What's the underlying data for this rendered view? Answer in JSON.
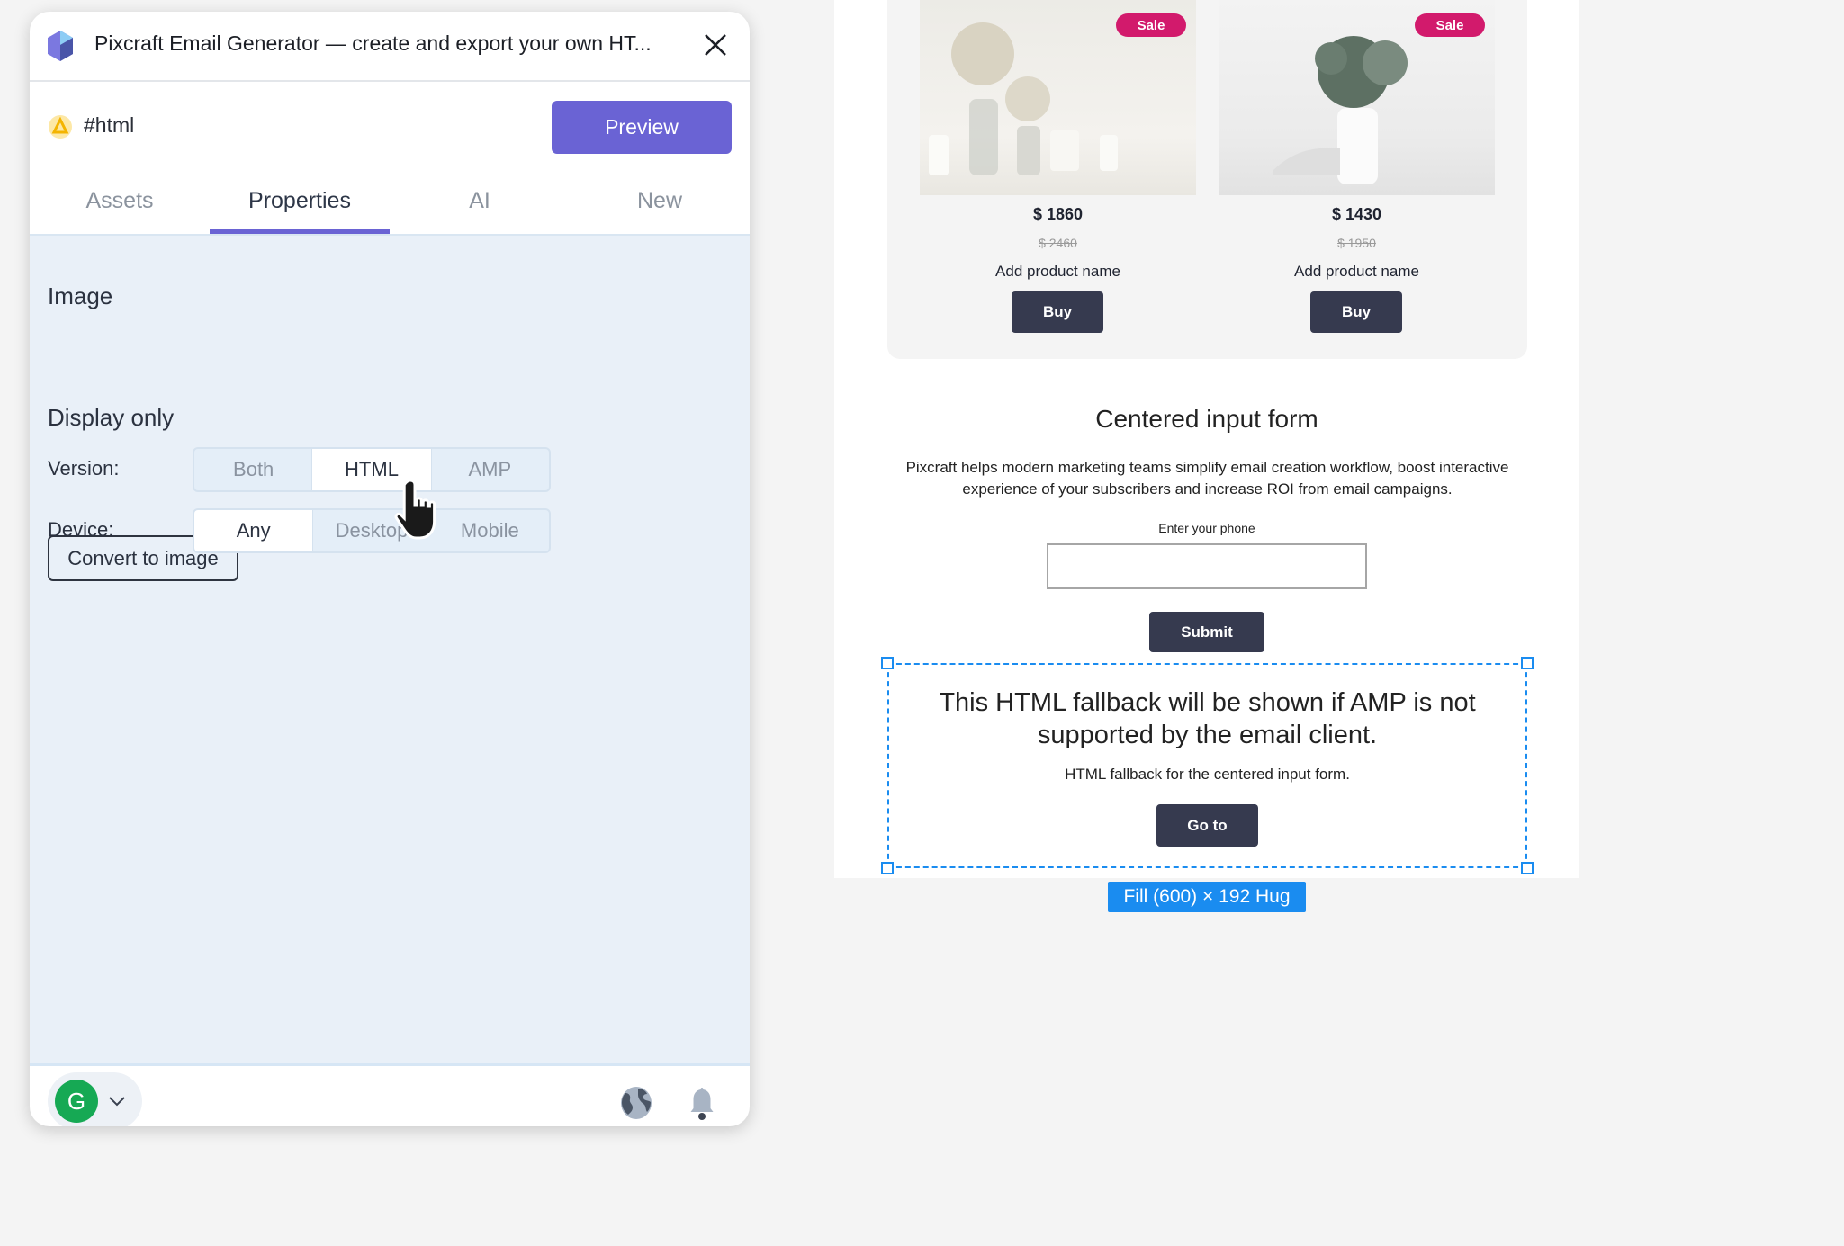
{
  "panel": {
    "title": "Pixcraft Email Generator — create and export your own HT...",
    "tag": "#html",
    "preview_label": "Preview",
    "tabs": [
      {
        "label": "Assets"
      },
      {
        "label": "Properties",
        "active": true
      },
      {
        "label": "AI"
      },
      {
        "label": "New"
      }
    ],
    "image_heading": "Image",
    "convert_label": "Convert to image",
    "display_heading": "Display only",
    "version": {
      "label": "Version:",
      "options": [
        "Both",
        "HTML",
        "AMP"
      ],
      "selected": "HTML"
    },
    "device": {
      "label": "Device:",
      "options": [
        "Any",
        "Desktop",
        "Mobile"
      ],
      "selected": "Any"
    },
    "user_initial": "G",
    "accent": "#6a63d4"
  },
  "email": {
    "products": [
      {
        "badge": "Sale",
        "price": "$ 1860",
        "old_price": "$ 2460",
        "name": "Add product name",
        "button": "Buy"
      },
      {
        "badge": "Sale",
        "price": "$ 1430",
        "old_price": "$ 1950",
        "name": "Add product name",
        "button": "Buy"
      }
    ],
    "form": {
      "title": "Centered input form",
      "description": "Pixcraft helps modern marketing teams simplify email creation workflow, boost interactive experience of your subscribers and increase ROI from email campaigns.",
      "phone_label": "Enter your phone",
      "phone_value": "",
      "submit": "Submit"
    },
    "fallback": {
      "title": "This HTML fallback will be shown if AMP is not supported by the email client.",
      "subtitle": "HTML fallback for the centered input form.",
      "button": "Go to"
    },
    "selection_label": "Fill (600) × 192 Hug"
  }
}
